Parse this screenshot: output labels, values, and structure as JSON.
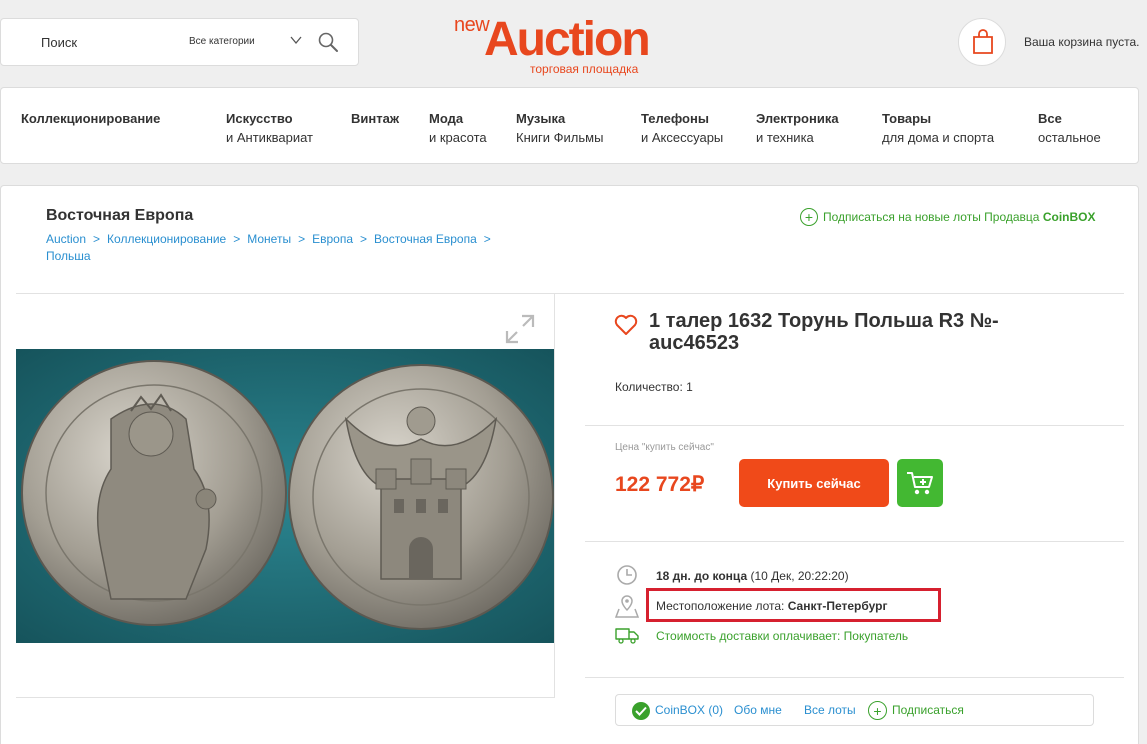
{
  "header": {
    "search_placeholder": "Поиск",
    "category": "Все категории",
    "logo_new": "new",
    "logo_main": "Auction",
    "logo_sub": "торговая площадка",
    "cart_text": "Ваша корзина пуста."
  },
  "nav": [
    {
      "l1": "Коллекционирование",
      "l2": ""
    },
    {
      "l1": "Искусство",
      "l2": "и Антиквариат"
    },
    {
      "l1": "Винтаж",
      "l2": ""
    },
    {
      "l1": "Мода",
      "l2": "и красота"
    },
    {
      "l1": "Музыка",
      "l2": "Книги Фильмы"
    },
    {
      "l1": "Телефоны",
      "l2": "и Аксессуары"
    },
    {
      "l1": "Электроника",
      "l2": "и техника"
    },
    {
      "l1": "Товары",
      "l2": "для дома и спорта"
    },
    {
      "l1": "Все",
      "l2": "остальное"
    }
  ],
  "page": {
    "title": "Восточная Европа",
    "breadcrumb": [
      "Auction",
      "Коллекционирование",
      "Монеты",
      "Европа",
      "Восточная Европа",
      "Польша"
    ],
    "breadcrumb_sep": ">",
    "subscribe_prefix": "Подписаться на новые лоты Продавца",
    "subscribe_seller": "CoinBOX"
  },
  "product": {
    "title": "1 талер 1632 Торунь Польша R3 №-auc46523",
    "quantity": "Количество: 1",
    "price_label": "Цена \"купить сейчас\"",
    "price": "122 772₽",
    "buy_label": "Купить сейчас",
    "time_bold": "18 дн. до конца",
    "time_rest": "(10 Дек, 20:22:20)",
    "location_label": "Местоположение лота:",
    "location_value": "Санкт-Петербург",
    "shipping": "Стоимость доставки оплачивает: Покупатель"
  },
  "seller_bar": {
    "seller": "CoinBOX (0)",
    "about": "Обо мне",
    "all_lots": "Все лоты",
    "subscribe": "Подписаться"
  },
  "colors": {
    "brand": "#e8471e",
    "buy": "#f04a19",
    "green": "#43b832",
    "link": "#2a8fd0",
    "highlight": "#d6202f"
  }
}
